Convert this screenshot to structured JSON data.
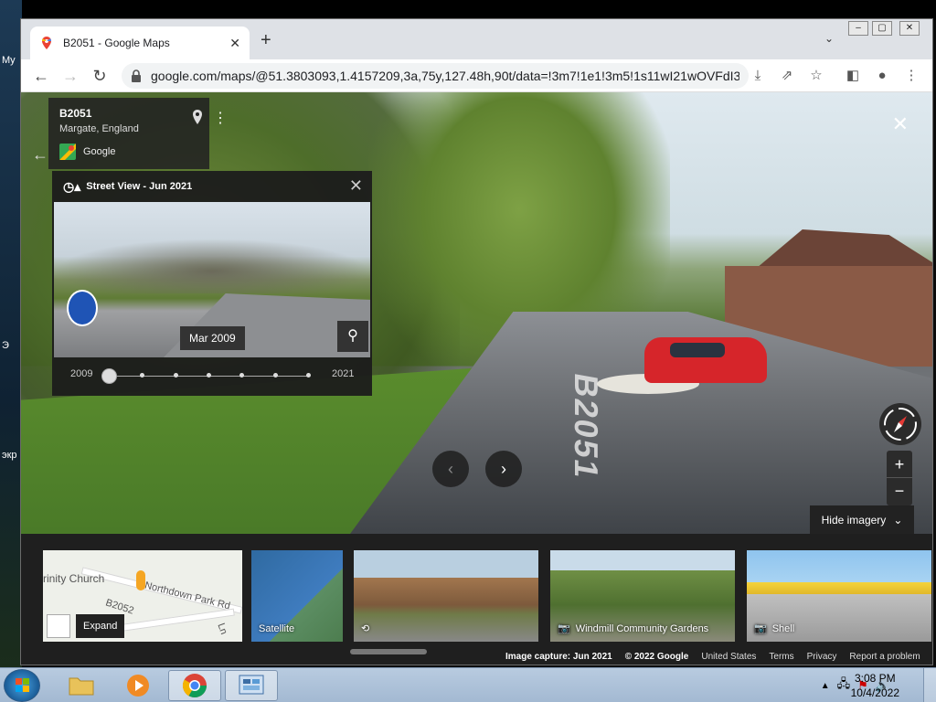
{
  "browser": {
    "tab_title": "B2051 - Google Maps",
    "new_tab": "+",
    "url": "google.com/maps/@51.3803093,1.4157209,3a,75y,127.48h,90t/data=!3m7!1e1!3m5!1s11wI21wOVFdI3..."
  },
  "place": {
    "title": "B2051",
    "subtitle": "Margate, England",
    "provider": "Google"
  },
  "time_machine": {
    "header": "Street View - Jun 2021",
    "selected_date": "Mar 2009",
    "start_year": "2009",
    "end_year": "2021",
    "stops": [
      2009,
      2011,
      2014,
      2016,
      2018,
      2019,
      2021
    ],
    "selected_index": 0
  },
  "controls": {
    "hide_imagery": "Hide imagery"
  },
  "carousel": {
    "map": {
      "church": "rinity Church",
      "road1": "B2052",
      "road2": "Northdown Park Rd",
      "road3": "Ln",
      "expand": "Expand"
    },
    "satellite": "Satellite",
    "garden": "Windmill Community Gardens",
    "shell": "Shell"
  },
  "footer": {
    "capture": "Image capture: Jun 2021",
    "copyright": "© 2022 Google",
    "country": "United States",
    "terms": "Terms",
    "privacy": "Privacy",
    "report": "Report a problem"
  },
  "desktop": {
    "label_top": "My",
    "label_mid": "Э",
    "label_bottom": "экр"
  },
  "taskbar": {
    "time": "3:08 PM",
    "date": "10/4/2022"
  }
}
